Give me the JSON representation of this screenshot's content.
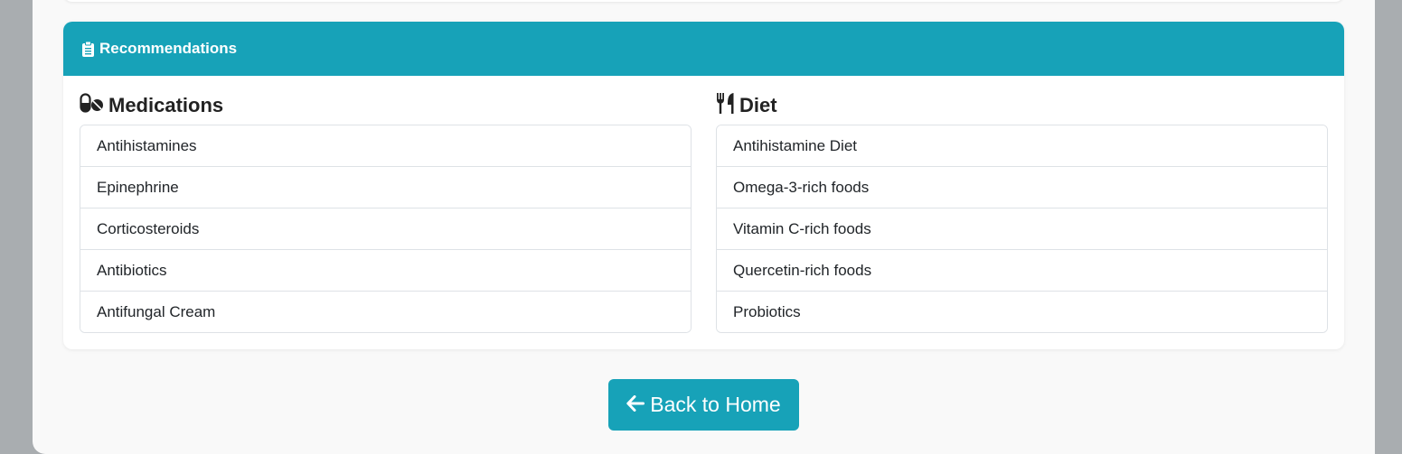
{
  "recommendations": {
    "title": "Recommendations",
    "icon": "clipboard-list-icon",
    "header_color": "#17a2b8"
  },
  "medications": {
    "title": "Medications",
    "icon": "pills-icon",
    "items": [
      "Antihistamines",
      "Epinephrine",
      "Corticosteroids",
      "Antibiotics",
      "Antifungal Cream"
    ]
  },
  "diet": {
    "title": "Diet",
    "icon": "utensils-icon",
    "items": [
      "Antihistamine Diet",
      "Omega-3-rich foods",
      "Vitamin C-rich foods",
      "Quercetin-rich foods",
      "Probiotics"
    ]
  },
  "back_button": {
    "label": "Back to Home",
    "icon": "arrow-left-icon",
    "color": "#17a2b8"
  }
}
